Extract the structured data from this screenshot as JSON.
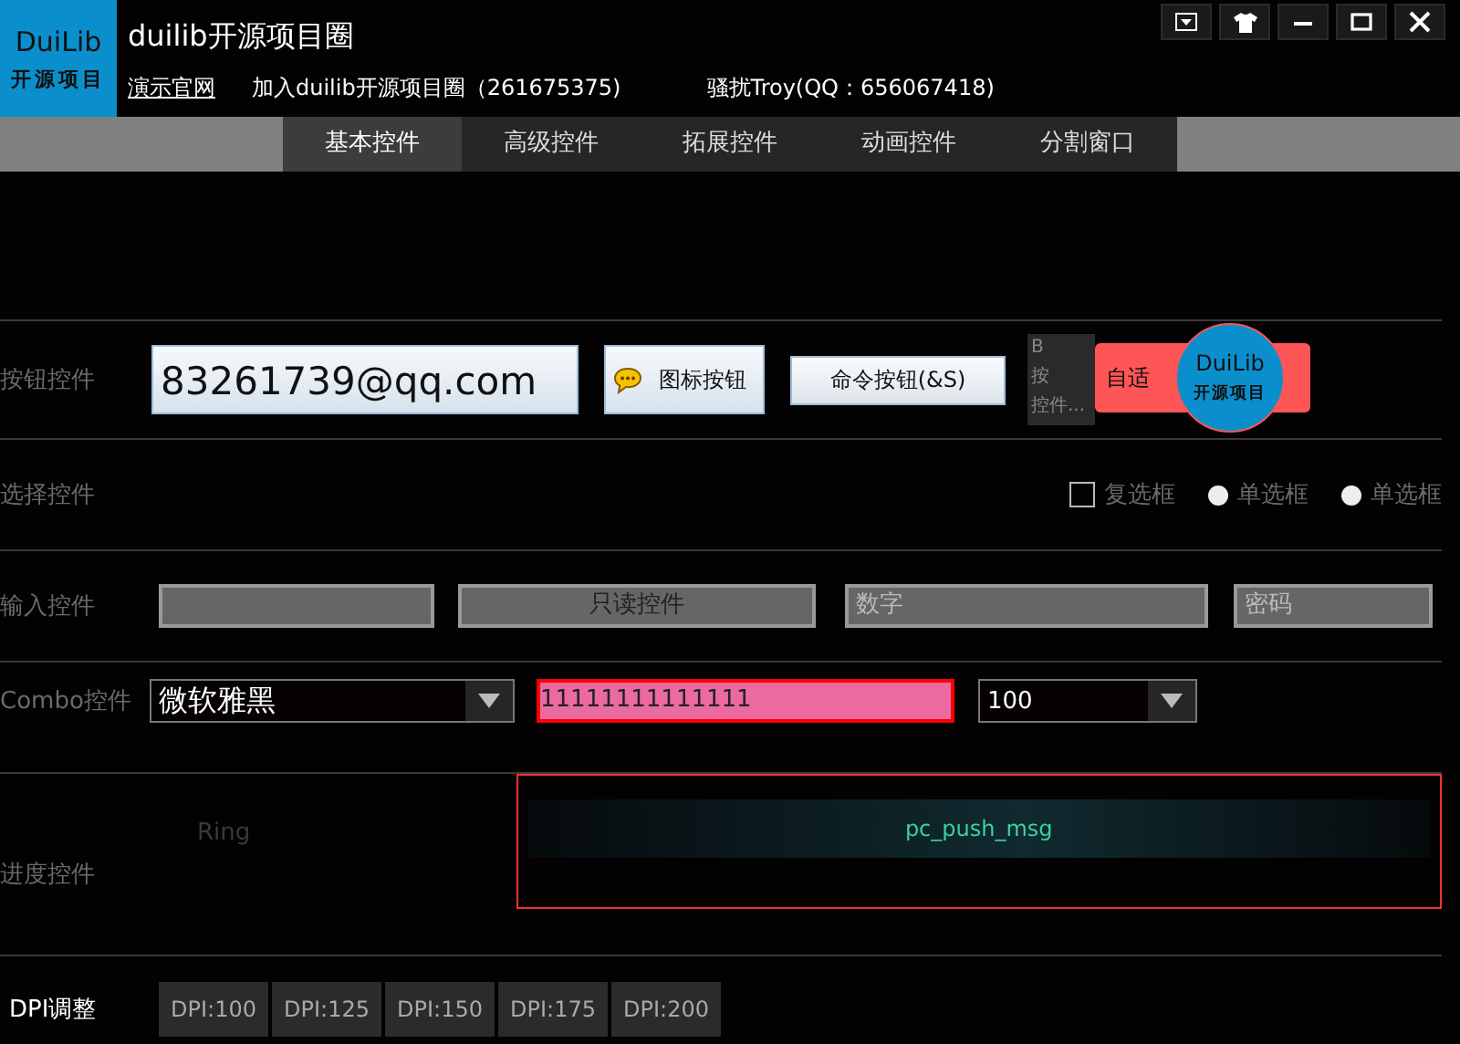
{
  "header": {
    "logo": [
      "DuiLib",
      "开源项目"
    ],
    "title": "duilib开源项目圈",
    "links": [
      {
        "kind": "link",
        "text": "演示官网"
      },
      {
        "kind": "text",
        "text": "加入duilib开源项目圈（261675375)"
      },
      {
        "kind": "text",
        "text": "骚扰Troy(QQ：656067418)"
      }
    ]
  },
  "tabs": [
    {
      "label": "基本控件",
      "selected": true
    },
    {
      "label": "高级控件",
      "selected": false
    },
    {
      "label": "拓展控件",
      "selected": false
    },
    {
      "label": "动画控件",
      "selected": false
    },
    {
      "label": "分割窗口",
      "selected": false
    }
  ],
  "button_controls": {
    "label": "按钮控件",
    "email": "83261739@qq.com",
    "icon_button": "图标按钮",
    "command_button": "命令按钮(&S)",
    "text_box_lines": [
      "B",
      "按",
      "控件..."
    ],
    "adaptive_button": "自适",
    "badge_logo": [
      "DuiLib",
      "开源项目"
    ]
  },
  "option_controls": {
    "label": "选择控件",
    "options": [
      {
        "kind": "checkbox",
        "label": "复选框",
        "checked": false
      },
      {
        "kind": "radio",
        "label": "单选框",
        "selected": false
      },
      {
        "kind": "radio",
        "label": "单选框",
        "selected": false
      }
    ]
  },
  "input_controls": {
    "label": "输入控件",
    "fields": [
      {
        "kind": "edit"
      },
      {
        "kind": "readonly",
        "value": "只读控件"
      },
      {
        "kind": "number",
        "placeholder": "数字"
      },
      {
        "kind": "password",
        "placeholder": "密码"
      }
    ]
  },
  "combo_controls": {
    "label": "Combo控件",
    "font_combo": "微软雅黑",
    "text_field": "11111111111111",
    "size_combo": "100"
  },
  "progress_controls": {
    "label": "进度控件",
    "ring": "Ring",
    "message": "pc_push_msg"
  },
  "dpi": {
    "label": "DPI调整",
    "options": [
      "DPI:100",
      "DPI:125",
      "DPI:150",
      "DPI:175",
      "DPI:200"
    ]
  }
}
